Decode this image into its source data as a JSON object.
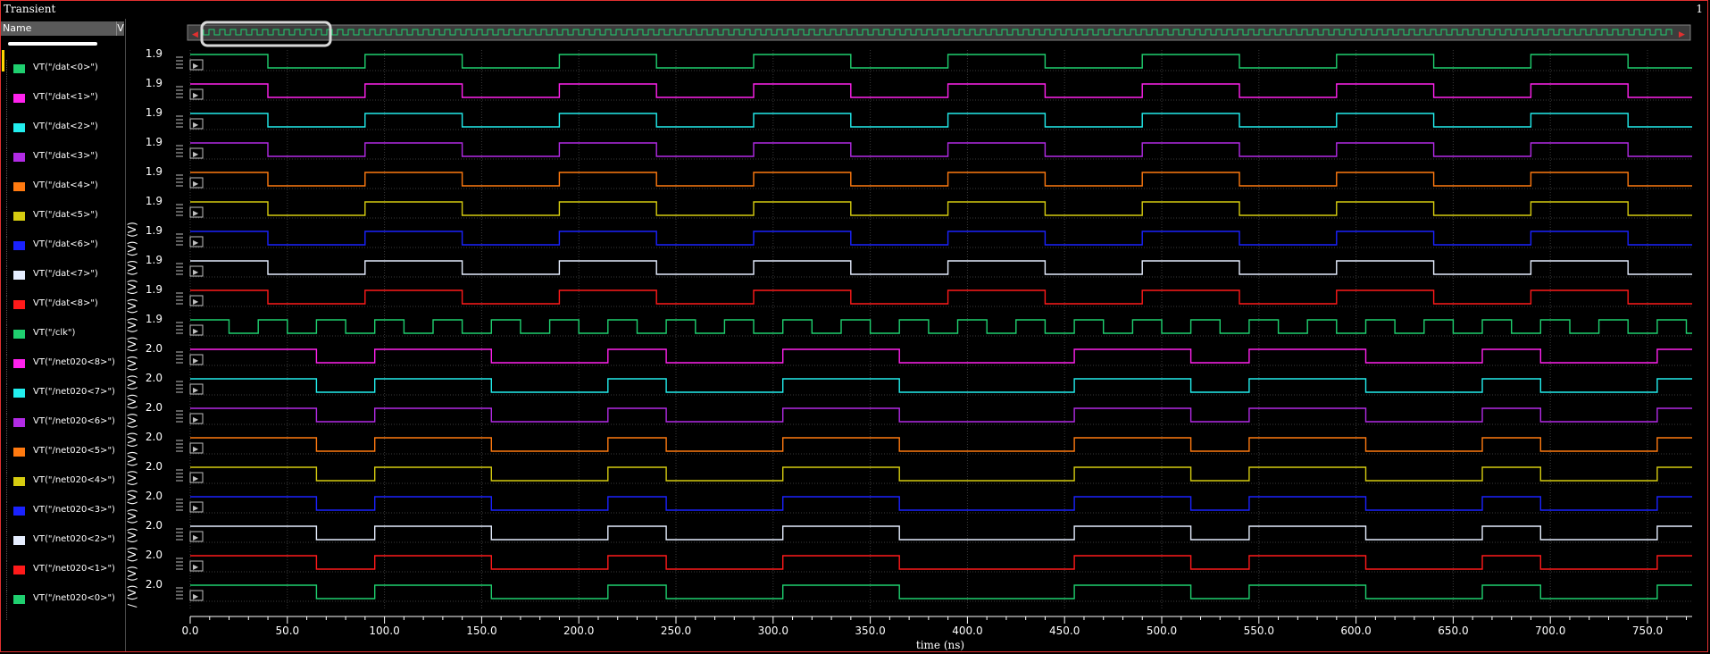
{
  "window": {
    "title": "Transient",
    "number": "1"
  },
  "panel": {
    "column_name": "Name",
    "column_v": "V"
  },
  "colors": {
    "green": "#1fcf6f",
    "magenta": "#ff22ee",
    "cyan": "#22eeee",
    "purple": "#b22be5",
    "orange": "#ff7a10",
    "yellow": "#d6cc10",
    "blue": "#1a22ff",
    "white": "#e6eeff",
    "red": "#ff1a1a",
    "grid": "#3a3a3a",
    "axis": "#ffffff",
    "frame": "#e03030"
  },
  "chart_data": {
    "type": "line",
    "title": "Transient",
    "xlabel": "time (ns)",
    "ylabel": "(V)",
    "xlim": [
      0,
      770
    ],
    "x_ticks": [
      "0.0",
      "50.0",
      "100.0",
      "150.0",
      "200.0",
      "250.0",
      "300.0",
      "350.0",
      "400.0",
      "450.0",
      "500.0",
      "550.0",
      "600.0",
      "650.0",
      "700.0",
      "750.0"
    ],
    "x_tick_values": [
      0,
      50,
      100,
      150,
      200,
      250,
      300,
      350,
      400,
      450,
      500,
      550,
      600,
      650,
      700,
      750
    ],
    "grid": true,
    "series": [
      {
        "name": "VT(\"/dat<0>\")",
        "color": "green",
        "ymax_label": "1.9",
        "vhigh": 1.8,
        "initial": 1,
        "transitions": [
          40,
          90,
          140,
          190,
          240,
          290,
          340,
          390,
          440,
          490,
          540,
          590,
          640,
          690,
          740
        ]
      },
      {
        "name": "VT(\"/dat<1>\")",
        "color": "magenta",
        "ymax_label": "1.9",
        "vhigh": 1.8,
        "initial": 1,
        "transitions": [
          40,
          90,
          140,
          190,
          240,
          290,
          340,
          390,
          440,
          490,
          540,
          590,
          640,
          690,
          740
        ]
      },
      {
        "name": "VT(\"/dat<2>\")",
        "color": "cyan",
        "ymax_label": "1.9",
        "vhigh": 1.8,
        "initial": 1,
        "transitions": [
          40,
          90,
          140,
          190,
          240,
          290,
          340,
          390,
          440,
          490,
          540,
          590,
          640,
          690,
          740
        ]
      },
      {
        "name": "VT(\"/dat<3>\")",
        "color": "purple",
        "ymax_label": "1.9",
        "vhigh": 1.8,
        "initial": 1,
        "transitions": [
          40,
          90,
          140,
          190,
          240,
          290,
          340,
          390,
          440,
          490,
          540,
          590,
          640,
          690,
          740
        ]
      },
      {
        "name": "VT(\"/dat<4>\")",
        "color": "orange",
        "ymax_label": "1.9",
        "vhigh": 1.8,
        "initial": 1,
        "transitions": [
          40,
          90,
          140,
          190,
          240,
          290,
          340,
          390,
          440,
          490,
          540,
          590,
          640,
          690,
          740
        ]
      },
      {
        "name": "VT(\"/dat<5>\")",
        "color": "yellow",
        "ymax_label": "1.9",
        "vhigh": 1.8,
        "initial": 1,
        "transitions": [
          40,
          90,
          140,
          190,
          240,
          290,
          340,
          390,
          440,
          490,
          540,
          590,
          640,
          690,
          740
        ]
      },
      {
        "name": "VT(\"/dat<6>\")",
        "color": "blue",
        "ymax_label": "1.9",
        "vhigh": 1.8,
        "initial": 1,
        "transitions": [
          40,
          90,
          140,
          190,
          240,
          290,
          340,
          390,
          440,
          490,
          540,
          590,
          640,
          690,
          740
        ]
      },
      {
        "name": "VT(\"/dat<7>\")",
        "color": "white",
        "ymax_label": "1.9",
        "vhigh": 1.8,
        "initial": 1,
        "transitions": [
          40,
          90,
          140,
          190,
          240,
          290,
          340,
          390,
          440,
          490,
          540,
          590,
          640,
          690,
          740
        ]
      },
      {
        "name": "VT(\"/dat<8>\")",
        "color": "red",
        "ymax_label": "1.9",
        "vhigh": 1.8,
        "initial": 1,
        "transitions": [
          40,
          90,
          140,
          190,
          240,
          290,
          340,
          390,
          440,
          490,
          540,
          590,
          640,
          690,
          740
        ]
      },
      {
        "name": "VT(\"/clk\")",
        "color": "green",
        "ymax_label": "1.9",
        "vhigh": 1.8,
        "initial": 1,
        "transitions": [
          20,
          35,
          50,
          65,
          80,
          95,
          110,
          125,
          140,
          155,
          170,
          185,
          200,
          215,
          230,
          245,
          260,
          275,
          290,
          305,
          320,
          335,
          350,
          365,
          380,
          395,
          410,
          425,
          440,
          455,
          470,
          485,
          500,
          515,
          530,
          545,
          560,
          575,
          590,
          605,
          620,
          635,
          650,
          665,
          680,
          695,
          710,
          725,
          740,
          755,
          770
        ]
      },
      {
        "name": "VT(\"/net020<8>\")",
        "color": "magenta",
        "ymax_label": "2.0",
        "vhigh": 1.9,
        "initial": 1,
        "transitions": [
          65,
          95,
          155,
          215,
          245,
          305,
          365,
          455,
          515,
          545,
          605,
          665,
          695,
          755
        ]
      },
      {
        "name": "VT(\"/net020<7>\")",
        "color": "cyan",
        "ymax_label": "2.0",
        "vhigh": 1.9,
        "initial": 1,
        "transitions": [
          65,
          95,
          155,
          215,
          245,
          305,
          365,
          455,
          515,
          545,
          605,
          665,
          695,
          755
        ]
      },
      {
        "name": "VT(\"/net020<6>\")",
        "color": "purple",
        "ymax_label": "2.0",
        "vhigh": 1.9,
        "initial": 1,
        "transitions": [
          65,
          95,
          155,
          215,
          245,
          305,
          365,
          455,
          515,
          545,
          605,
          665,
          695,
          755
        ]
      },
      {
        "name": "VT(\"/net020<5>\")",
        "color": "orange",
        "ymax_label": "2.0",
        "vhigh": 1.9,
        "initial": 1,
        "transitions": [
          65,
          95,
          155,
          215,
          245,
          305,
          365,
          455,
          515,
          545,
          605,
          665,
          695,
          755
        ]
      },
      {
        "name": "VT(\"/net020<4>\")",
        "color": "yellow",
        "ymax_label": "2.0",
        "vhigh": 1.9,
        "initial": 1,
        "transitions": [
          65,
          95,
          155,
          215,
          245,
          305,
          365,
          455,
          515,
          545,
          605,
          665,
          695,
          755
        ]
      },
      {
        "name": "VT(\"/net020<3>\")",
        "color": "blue",
        "ymax_label": "2.0",
        "vhigh": 1.9,
        "initial": 1,
        "transitions": [
          65,
          95,
          155,
          215,
          245,
          305,
          365,
          455,
          515,
          545,
          605,
          665,
          695,
          755
        ]
      },
      {
        "name": "VT(\"/net020<2>\")",
        "color": "white",
        "ymax_label": "2.0",
        "vhigh": 1.9,
        "initial": 1,
        "transitions": [
          65,
          95,
          155,
          215,
          245,
          305,
          365,
          455,
          515,
          545,
          605,
          665,
          695,
          755
        ]
      },
      {
        "name": "VT(\"/net020<1>\")",
        "color": "red",
        "ymax_label": "2.0",
        "vhigh": 1.9,
        "initial": 1,
        "transitions": [
          65,
          95,
          155,
          215,
          245,
          305,
          365,
          455,
          515,
          545,
          605,
          665,
          695,
          755
        ]
      },
      {
        "name": "VT(\"/net020<0>\")",
        "color": "green",
        "ymax_label": "2.0",
        "vhigh": 1.9,
        "initial": 1,
        "transitions": [
          65,
          95,
          155,
          215,
          245,
          305,
          365,
          455,
          515,
          545,
          605,
          665,
          695,
          755
        ]
      }
    ]
  }
}
